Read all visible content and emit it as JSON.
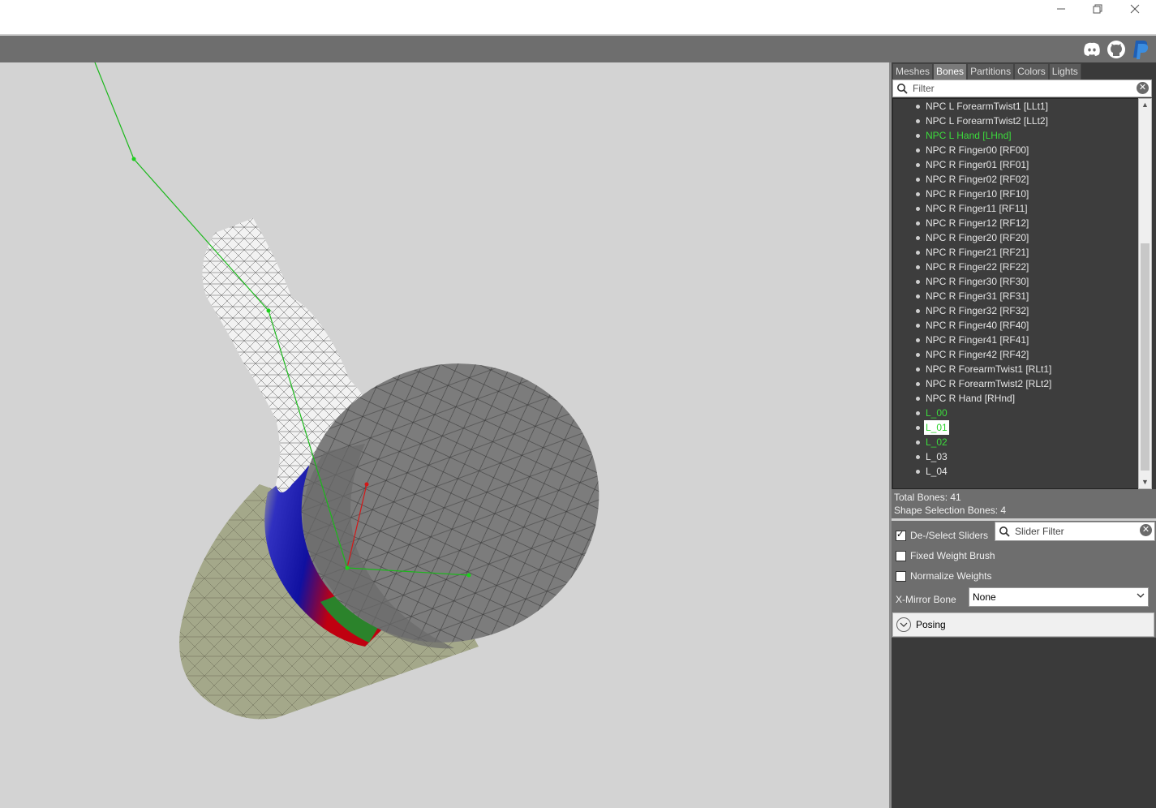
{
  "window": {
    "minimize_glyph": "—",
    "restore_glyph": "❐",
    "close_glyph": "✕"
  },
  "toolbar": {
    "icons": [
      "discord-icon",
      "github-icon",
      "paypal-icon"
    ],
    "colors": {
      "discord": "#ffffff",
      "github": "#ffffff",
      "paypal": "#1f5fb5"
    }
  },
  "tabs": [
    "Meshes",
    "Bones",
    "Partitions",
    "Colors",
    "Lights"
  ],
  "active_tab": "Bones",
  "filter": {
    "placeholder": "Filter"
  },
  "bones": [
    {
      "label": "NPC L ForearmTwist1 [LLt1]",
      "state": "normal"
    },
    {
      "label": "NPC L ForearmTwist2 [LLt2]",
      "state": "normal"
    },
    {
      "label": "NPC L Hand [LHnd]",
      "state": "green"
    },
    {
      "label": "NPC R Finger00 [RF00]",
      "state": "normal"
    },
    {
      "label": "NPC R Finger01 [RF01]",
      "state": "normal"
    },
    {
      "label": "NPC R Finger02 [RF02]",
      "state": "normal"
    },
    {
      "label": "NPC R Finger10 [RF10]",
      "state": "normal"
    },
    {
      "label": "NPC R Finger11 [RF11]",
      "state": "normal"
    },
    {
      "label": "NPC R Finger12 [RF12]",
      "state": "normal"
    },
    {
      "label": "NPC R Finger20 [RF20]",
      "state": "normal"
    },
    {
      "label": "NPC R Finger21 [RF21]",
      "state": "normal"
    },
    {
      "label": "NPC R Finger22 [RF22]",
      "state": "normal"
    },
    {
      "label": "NPC R Finger30 [RF30]",
      "state": "normal"
    },
    {
      "label": "NPC R Finger31 [RF31]",
      "state": "normal"
    },
    {
      "label": "NPC R Finger32 [RF32]",
      "state": "normal"
    },
    {
      "label": "NPC R Finger40 [RF40]",
      "state": "normal"
    },
    {
      "label": "NPC R Finger41 [RF41]",
      "state": "normal"
    },
    {
      "label": "NPC R Finger42 [RF42]",
      "state": "normal"
    },
    {
      "label": "NPC R ForearmTwist1 [RLt1]",
      "state": "normal"
    },
    {
      "label": "NPC R ForearmTwist2 [RLt2]",
      "state": "normal"
    },
    {
      "label": "NPC R Hand [RHnd]",
      "state": "normal"
    },
    {
      "label": "L_00",
      "state": "green"
    },
    {
      "label": "L_01",
      "state": "selected"
    },
    {
      "label": "L_02",
      "state": "green"
    },
    {
      "label": "L_03",
      "state": "normal"
    },
    {
      "label": "L_04",
      "state": "normal"
    }
  ],
  "stats": {
    "total_bones": "Total Bones: 41",
    "shape_selection_bones": "Shape Selection Bones: 4"
  },
  "controls": {
    "deselect_sliders": {
      "label": "De-/Select Sliders",
      "checked": true
    },
    "slider_filter": {
      "placeholder": "Slider Filter"
    },
    "fixed_weight_brush": {
      "label": "Fixed Weight Brush",
      "checked": false
    },
    "normalize_weights": {
      "label": "Normalize Weights",
      "checked": false
    },
    "xmirror": {
      "label": "X-Mirror Bone",
      "value": "None"
    },
    "posing": {
      "label": "Posing"
    }
  }
}
